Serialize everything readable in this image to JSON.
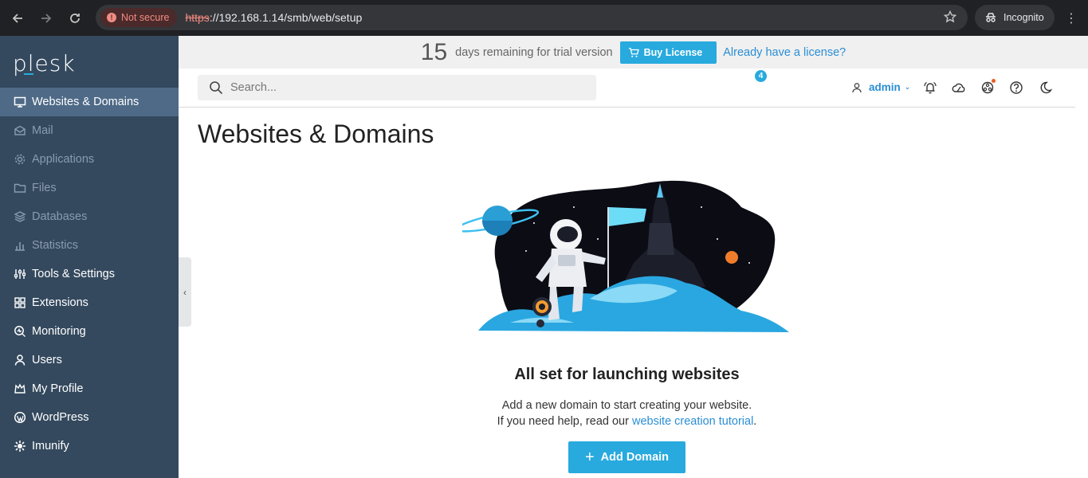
{
  "browser": {
    "not_secure": "Not secure",
    "url_scheme": "https",
    "url_rest": "://192.168.1.14/smb/web/setup",
    "incognito": "Incognito"
  },
  "sidebar": {
    "logo": "plesk",
    "items": [
      {
        "label": "Websites & Domains",
        "icon": "monitor-icon"
      },
      {
        "label": "Mail",
        "icon": "mail-icon"
      },
      {
        "label": "Applications",
        "icon": "gear-icon"
      },
      {
        "label": "Files",
        "icon": "folder-icon"
      },
      {
        "label": "Databases",
        "icon": "database-icon"
      },
      {
        "label": "Statistics",
        "icon": "bar-chart-icon"
      },
      {
        "label": "Tools & Settings",
        "icon": "sliders-icon"
      },
      {
        "label": "Extensions",
        "icon": "extensions-icon"
      },
      {
        "label": "Monitoring",
        "icon": "monitoring-icon"
      },
      {
        "label": "Users",
        "icon": "user-icon"
      },
      {
        "label": "My Profile",
        "icon": "profile-icon"
      },
      {
        "label": "WordPress",
        "icon": "wordpress-icon"
      },
      {
        "label": "Imunify",
        "icon": "imunify-icon"
      }
    ]
  },
  "trial": {
    "days": "15",
    "text": "days remaining for trial version",
    "buy_label": "Buy License",
    "have_license": "Already have a license?"
  },
  "topbar": {
    "search_placeholder": "Search...",
    "user": "admin",
    "notifications_count": "4"
  },
  "main": {
    "title": "Websites & Domains",
    "empty_title": "All set for launching websites",
    "empty_line1": "Add a new domain to start creating your website.",
    "empty_line2_prefix": "If you need help, read our ",
    "empty_link": "website creation tutorial",
    "empty_line2_suffix": ".",
    "add_domain": "Add Domain"
  },
  "colors": {
    "sidebar_bg": "#34495e",
    "sidebar_active": "#4e6a87",
    "accent": "#28aade",
    "link": "#2a8ed4"
  }
}
